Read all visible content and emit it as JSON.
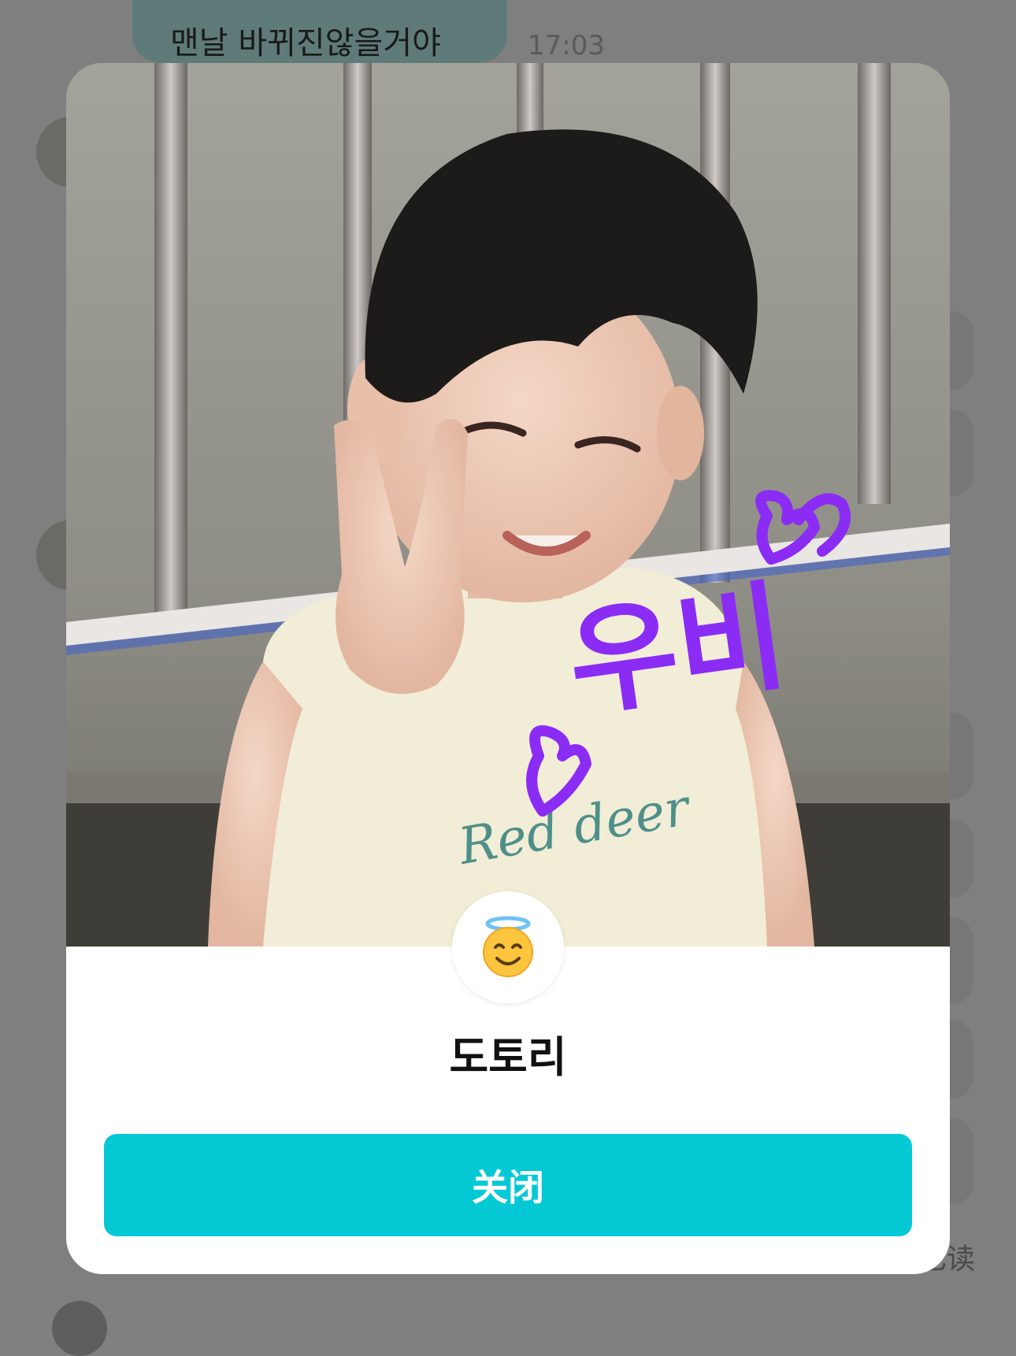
{
  "chat": {
    "message_text": "맨날 바뀌진않을거야",
    "message_time": "17:03",
    "read_status": "已读"
  },
  "profile_modal": {
    "photo_caption": "우비",
    "shirt_print": "Red deer",
    "status_emoji_icon": "smiling-face-with-halo-icon",
    "display_name": "도토리",
    "close_label": "关闭"
  },
  "colors": {
    "overlay": "#7f7f7f",
    "close_button": "#04c9d5",
    "caption_purple": "#8b2cf5",
    "bubble": "#5f7b79"
  }
}
